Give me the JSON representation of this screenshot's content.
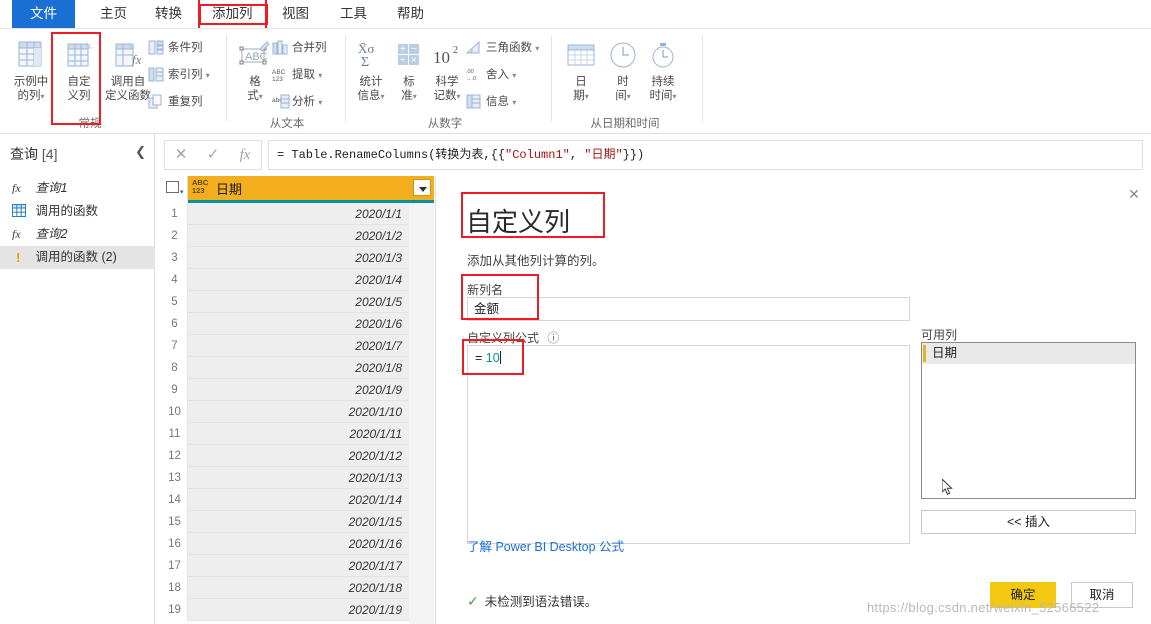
{
  "app": {
    "watermark": "https://blog.csdn.net/weixin_52566522"
  },
  "ribbon": {
    "tabs": [
      {
        "label": "文件"
      },
      {
        "label": "主页"
      },
      {
        "label": "转换"
      },
      {
        "label": "添加列"
      },
      {
        "label": "视图"
      },
      {
        "label": "工具"
      },
      {
        "label": "帮助"
      }
    ],
    "active_tab": "添加列",
    "groups": [
      {
        "name": "常规",
        "big_buttons": [
          {
            "label_line1": "示例中",
            "label_line2": "的列",
            "icon": "column-from-example-icon",
            "caret": true
          },
          {
            "label_line1": "自定",
            "label_line2": "义列",
            "icon": "custom-column-icon",
            "caret": false
          },
          {
            "label_line1": "调用自",
            "label_line2": "定义函数",
            "icon": "invoke-custom-function-icon",
            "caret": false
          }
        ],
        "small_buttons": [
          {
            "label": "条件列",
            "icon": "conditional-column-icon",
            "caret": false
          },
          {
            "label": "索引列",
            "icon": "index-column-icon",
            "caret": true
          },
          {
            "label": "重复列",
            "icon": "duplicate-column-icon",
            "caret": false
          }
        ]
      },
      {
        "name": "从文本",
        "big_buttons": [
          {
            "label_line1": "格",
            "label_line2": "式",
            "icon": "format-abc-icon",
            "caret": true
          }
        ],
        "small_buttons": [
          {
            "label": "合并列",
            "icon": "merge-columns-icon",
            "caret": false
          },
          {
            "label": "提取",
            "icon": "extract-icon",
            "caret": true
          },
          {
            "label": "分析",
            "icon": "parse-icon",
            "caret": true
          }
        ]
      },
      {
        "name": "从数字",
        "big_buttons": [
          {
            "label_line1": "统计",
            "label_line2": "信息",
            "icon": "statistics-icon",
            "caret": true
          },
          {
            "label_line1": "标",
            "label_line2": "准",
            "icon": "standard-icon",
            "caret": true
          },
          {
            "label_line1": "科学",
            "label_line2": "记数",
            "icon": "scientific-icon",
            "caret": true
          }
        ],
        "small_buttons": [
          {
            "label": "三角函数",
            "icon": "trigonometry-icon",
            "caret": true
          },
          {
            "label": "舍入",
            "icon": "rounding-icon",
            "caret": true
          },
          {
            "label": "信息",
            "icon": "information-icon",
            "caret": true
          }
        ]
      },
      {
        "name": "从日期和时间",
        "big_buttons": [
          {
            "label_line1": "日",
            "label_line2": "期",
            "icon": "calendar-icon",
            "caret": true
          },
          {
            "label_line1": "时",
            "label_line2": "间",
            "icon": "clock-icon",
            "caret": true
          },
          {
            "label_line1": "持续",
            "label_line2": "时间",
            "icon": "duration-icon",
            "caret": true
          }
        ],
        "small_buttons": []
      }
    ]
  },
  "queries_pane": {
    "title": "查询",
    "count": "[4]",
    "collapse_icon": "chevron-left-icon",
    "items": [
      {
        "label": "查询1",
        "icon": "fx-icon",
        "italic": true,
        "selected": false
      },
      {
        "label": "调用的函数",
        "icon": "table-icon",
        "italic": false,
        "selected": false
      },
      {
        "label": "查询2",
        "icon": "fx-icon",
        "italic": true,
        "selected": false
      },
      {
        "label": "调用的函数 (2)",
        "icon": "warning-icon",
        "italic": false,
        "selected": true
      }
    ]
  },
  "formula_bar": {
    "cancel_icon": "close-icon",
    "accept_icon": "check-icon",
    "fx_icon": "fx-icon",
    "prefix": "= Table.RenameColumns(转换为表,{{",
    "str1": "\"Column1\"",
    "mid": ", ",
    "str2": "\"日期\"",
    "suffix": "}})"
  },
  "grid": {
    "type_badge": "ABC\n123",
    "column_name": "日期",
    "rows": [
      {
        "index": "1",
        "value": "2020/1/1"
      },
      {
        "index": "2",
        "value": "2020/1/2"
      },
      {
        "index": "3",
        "value": "2020/1/3"
      },
      {
        "index": "4",
        "value": "2020/1/4"
      },
      {
        "index": "5",
        "value": "2020/1/5"
      },
      {
        "index": "6",
        "value": "2020/1/6"
      },
      {
        "index": "7",
        "value": "2020/1/7"
      },
      {
        "index": "8",
        "value": "2020/1/8"
      },
      {
        "index": "9",
        "value": "2020/1/9"
      },
      {
        "index": "10",
        "value": "2020/1/10"
      },
      {
        "index": "11",
        "value": "2020/1/11"
      },
      {
        "index": "12",
        "value": "2020/1/12"
      },
      {
        "index": "13",
        "value": "2020/1/13"
      },
      {
        "index": "14",
        "value": "2020/1/14"
      },
      {
        "index": "15",
        "value": "2020/1/15"
      },
      {
        "index": "16",
        "value": "2020/1/16"
      },
      {
        "index": "17",
        "value": "2020/1/17"
      },
      {
        "index": "18",
        "value": "2020/1/18"
      },
      {
        "index": "19",
        "value": "2020/1/19"
      }
    ]
  },
  "dialog": {
    "title": "自定义列",
    "subtitle": "添加从其他列计算的列。",
    "close_label": "✕",
    "new_column_label": "新列名",
    "new_column_value": "金额",
    "new_column_placeholder": "",
    "formula_label": "自定义列公式",
    "formula_info_icon": "info-icon",
    "formula_prefix": "= ",
    "formula_value": "10",
    "learn_link": "了解 Power BI Desktop 公式",
    "status_icon": "check-icon",
    "status_text": "未检测到语法错误。",
    "available_label": "可用列",
    "available_columns": [
      "日期"
    ],
    "insert_button": "<< 插入",
    "ok_button": "确定",
    "cancel_button": "取消"
  },
  "colors": {
    "accent_blue": "#1a6fd4",
    "highlight_red": "#ee1c25",
    "header_yellow": "#f2ae1c",
    "ok_yellow": "#f2c811",
    "quality_teal": "#00939b",
    "green_accent": "#00a06d"
  }
}
